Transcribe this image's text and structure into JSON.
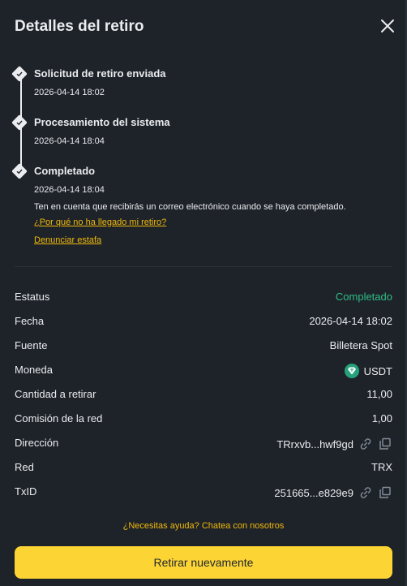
{
  "header": {
    "title": "Detalles del retiro",
    "close_icon": "close-icon"
  },
  "timeline": {
    "steps": [
      {
        "label": "Solicitud de retiro enviada",
        "time": "2026-04-14 18:02"
      },
      {
        "label": "Procesamiento del sistema",
        "time": "2026-04-14 18:04"
      },
      {
        "label": "Completado",
        "time": "2026-04-14 18:04"
      }
    ],
    "note": "Ten en cuenta que recibirás un correo electrónico cuando se haya completado.",
    "why_link": "¿Por qué no ha llegado mi retiro?",
    "report_link": "Denunciar estafa"
  },
  "details": {
    "status": {
      "label": "Estatus",
      "value": "Completado"
    },
    "date": {
      "label": "Fecha",
      "value": "2026-04-14 18:02"
    },
    "source": {
      "label": "Fuente",
      "value": "Billetera Spot"
    },
    "coin": {
      "label": "Moneda",
      "value": "USDT"
    },
    "amount": {
      "label": "Cantidad a retirar",
      "value": "11,00"
    },
    "fee": {
      "label": "Comisión de la red",
      "value": "1,00"
    },
    "address": {
      "label": "Dirección",
      "value": "TRrxvb...hwf9gd"
    },
    "network": {
      "label": "Red",
      "value": "TRX"
    },
    "txid": {
      "label": "TxID",
      "value": "251665...e829e9"
    }
  },
  "help_text": "¿Necesitas ayuda? Chatea con nosotros",
  "primary_button": "Retirar nuevamente",
  "colors": {
    "accent": "#fcd535",
    "link": "#f0b90b",
    "success": "#2ebd85",
    "background": "#1e2329"
  }
}
